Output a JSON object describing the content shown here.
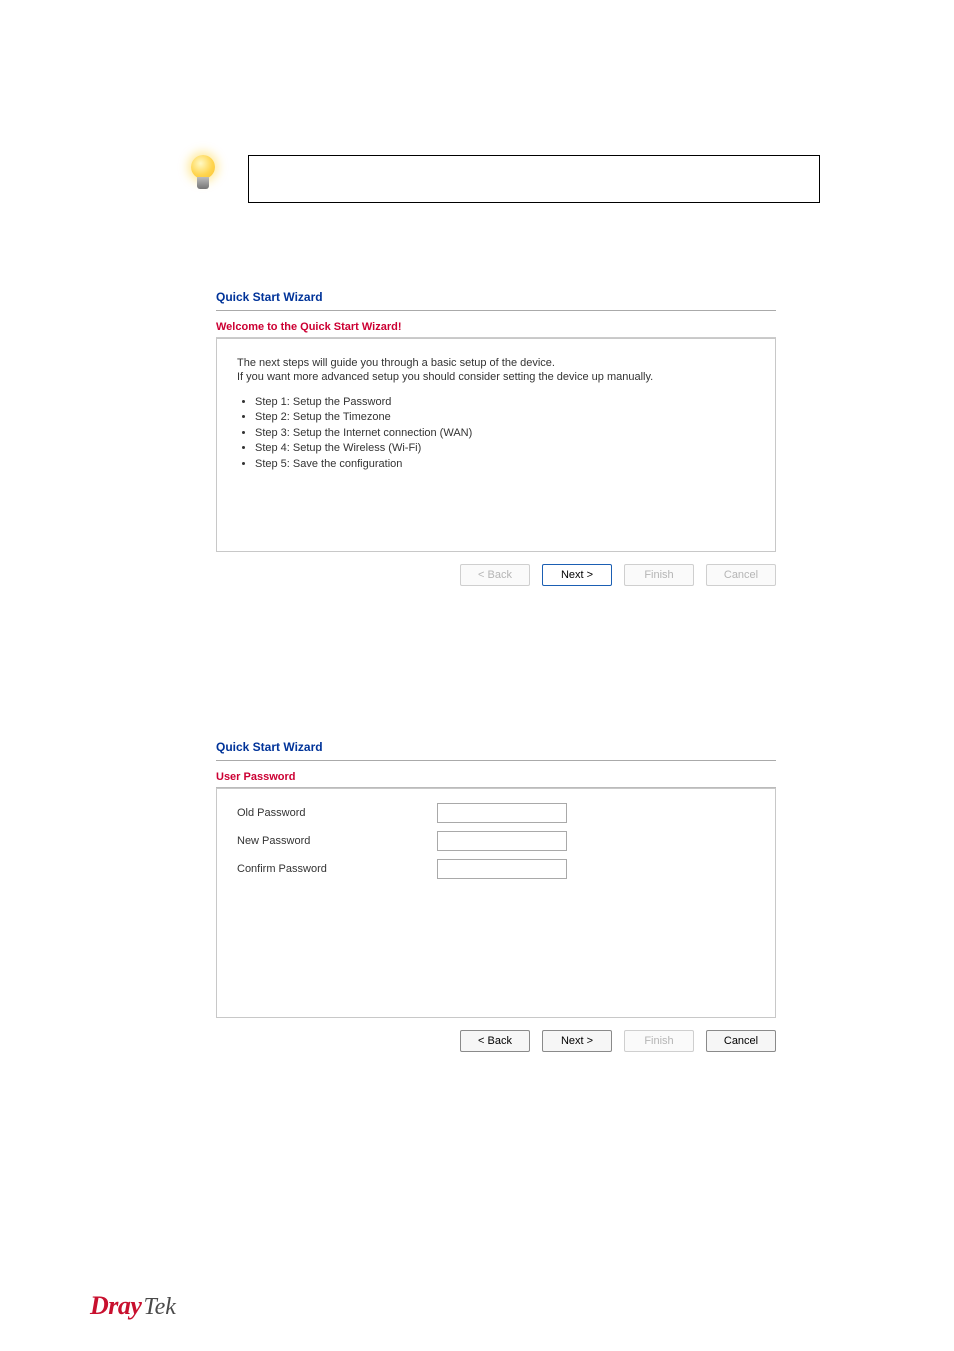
{
  "panel1": {
    "title": "Quick Start Wizard",
    "subtitle": "Welcome to the Quick Start Wizard!",
    "intro1": "The next steps will guide you through a basic setup of the device.",
    "intro2": "If you want more advanced setup you should consider setting the device up manually.",
    "steps": [
      "Step 1: Setup the Password",
      "Step 2: Setup the Timezone",
      "Step 3: Setup the Internet connection (WAN)",
      "Step 4: Setup the Wireless (Wi-Fi)",
      "Step 5: Save the configuration"
    ],
    "buttons": {
      "back": "< Back",
      "next": "Next >",
      "finish": "Finish",
      "cancel": "Cancel"
    }
  },
  "panel2": {
    "title": "Quick Start Wizard",
    "subtitle": "User Password",
    "fields": {
      "old": "Old Password",
      "new": "New Password",
      "confirm": "Confirm Password"
    },
    "buttons": {
      "back": "< Back",
      "next": "Next >",
      "finish": "Finish",
      "cancel": "Cancel"
    }
  },
  "brand": {
    "part1": "Dray",
    "part2": "Tek"
  }
}
